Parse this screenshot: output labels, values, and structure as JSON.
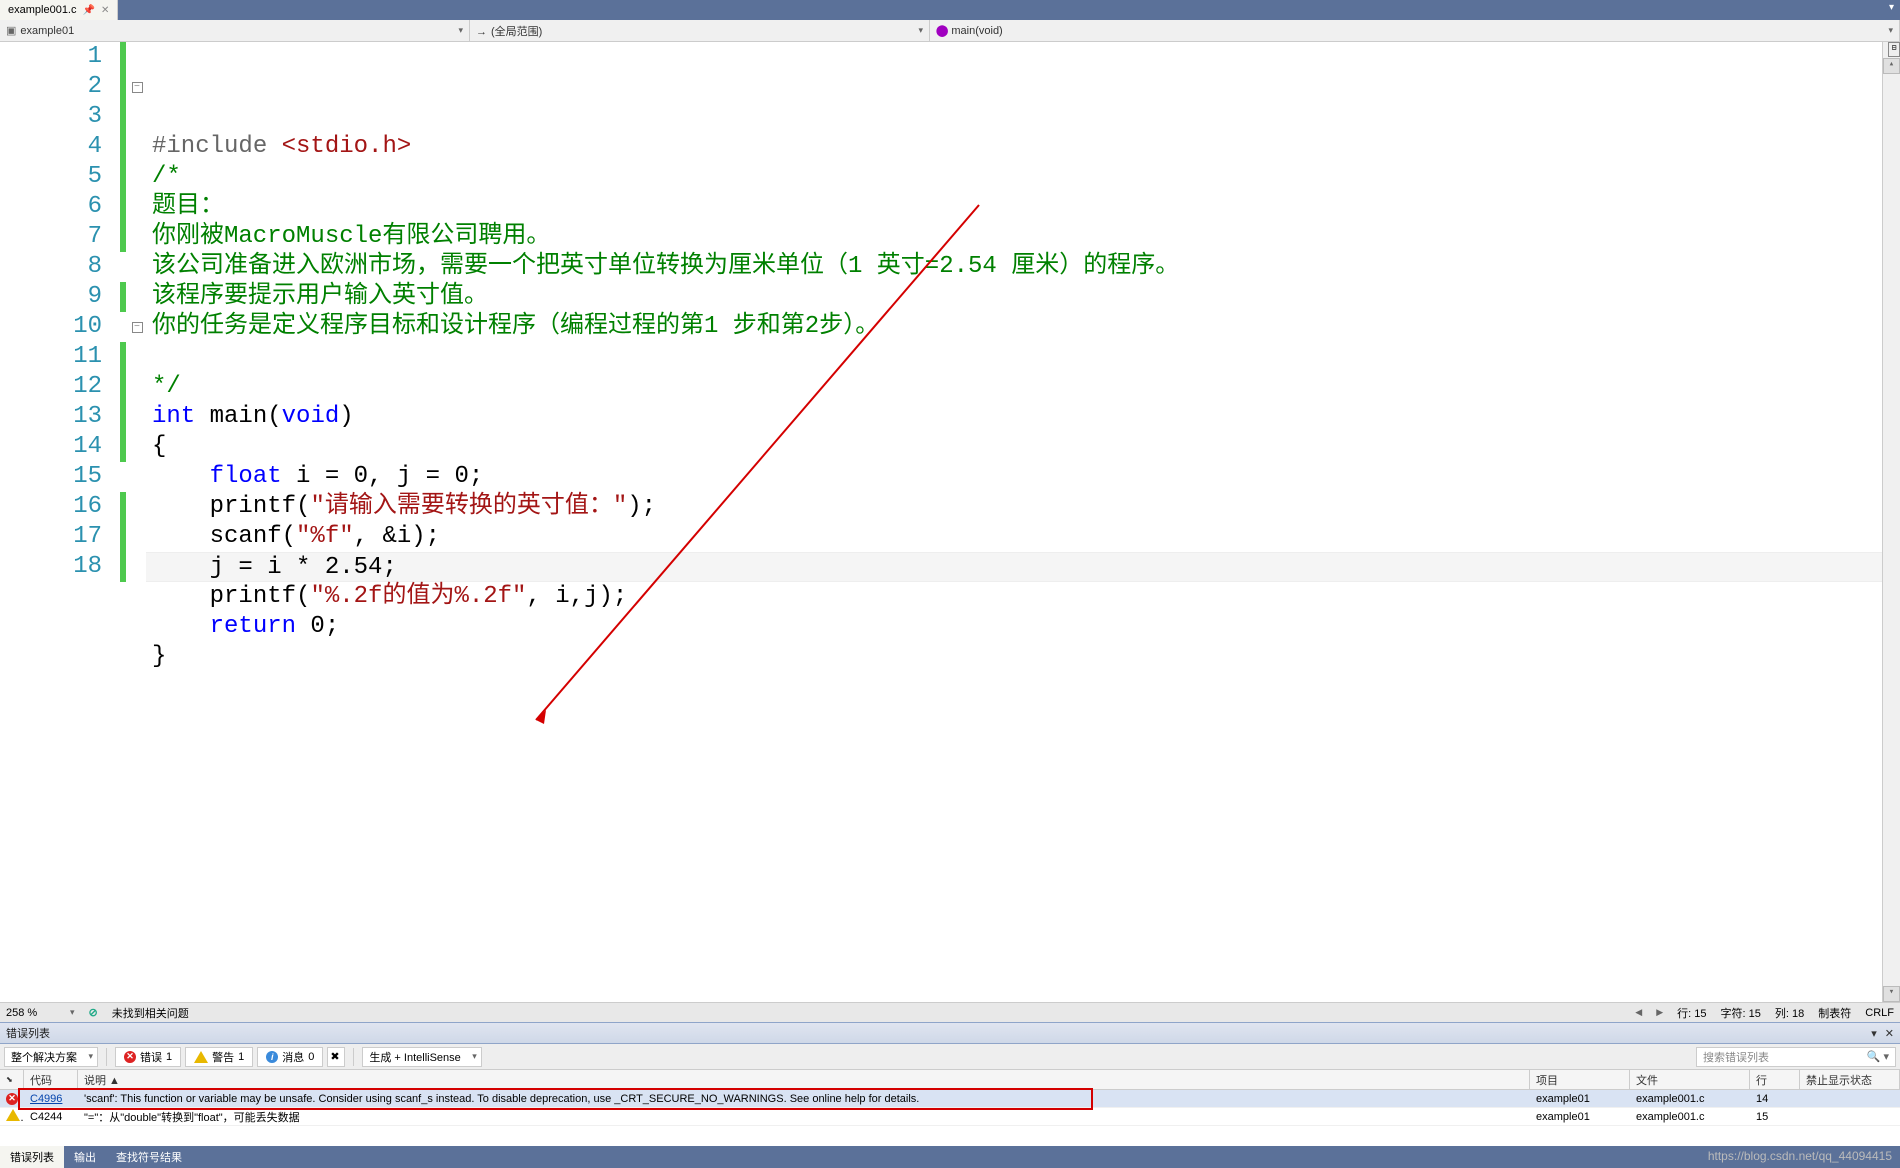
{
  "tabs": {
    "file": "example001.c"
  },
  "navbar": {
    "left": "example01",
    "middle": "(全局范围)",
    "right": "main(void)"
  },
  "code": {
    "lines": [
      {
        "n": 1,
        "html": "<span class='preproc'>#include</span> <span class='string'>&lt;stdio.h&gt;</span>",
        "changed": true
      },
      {
        "n": 2,
        "html": "<span class='comment'>/*</span>",
        "changed": true,
        "outline": "-"
      },
      {
        "n": 3,
        "html": "<span class='comment'>题目：</span>",
        "changed": true
      },
      {
        "n": 4,
        "html": "<span class='comment'>你刚被MacroMuscle有限公司聘用。</span>",
        "changed": true
      },
      {
        "n": 5,
        "html": "<span class='comment'>该公司准备进入欧洲市场，需要一个把英寸单位转换为厘米单位（1 英寸=2.54 厘米）的程序。</span>",
        "changed": true
      },
      {
        "n": 6,
        "html": "<span class='comment'>该程序要提示用户输入英寸值。</span>",
        "changed": true
      },
      {
        "n": 7,
        "html": "<span class='comment'>你的任务是定义程序目标和设计程序（编程过程的第1 步和第2步）。</span>",
        "changed": true
      },
      {
        "n": 8,
        "html": "",
        "changed": false
      },
      {
        "n": 9,
        "html": "<span class='comment'>*/</span>",
        "changed": true
      },
      {
        "n": 10,
        "html": "<span class='keyword'>int</span> main(<span class='keyword'>void</span>)",
        "changed": false,
        "outline": "-"
      },
      {
        "n": 11,
        "html": "{",
        "changed": true
      },
      {
        "n": 12,
        "html": "    <span class='keyword'>float</span> i = 0, j = 0;",
        "changed": true
      },
      {
        "n": 13,
        "html": "    printf(<span class='string'>\"请输入需要转换的英寸值：\"</span>);",
        "changed": true
      },
      {
        "n": 14,
        "html": "    scanf(<span class='string'>\"%f\"</span>, &amp;i);",
        "changed": true
      },
      {
        "n": 15,
        "html": "    j = i * 2.54;",
        "changed": false,
        "hl": true
      },
      {
        "n": 16,
        "html": "    printf(<span class='string'>\"%.2f的值为%.2f\"</span>, i,j);",
        "changed": true
      },
      {
        "n": 17,
        "html": "    <span class='keyword'>return</span> 0;",
        "changed": true
      },
      {
        "n": 18,
        "html": "}",
        "changed": true
      }
    ]
  },
  "status": {
    "zoom": "258 %",
    "issues": "未找到相关问题",
    "line_lbl": "行:",
    "line_val": "15",
    "char_lbl": "字符:",
    "char_val": "15",
    "col_lbl": "列:",
    "col_val": "18",
    "tabs_mode": "制表符",
    "crlf": "CRLF"
  },
  "error_panel": {
    "title": "错误列表",
    "scope": "整个解决方案",
    "errors_lbl": "错误",
    "errors_count": "1",
    "warnings_lbl": "警告",
    "warnings_count": "1",
    "messages_lbl": "消息",
    "messages_count": "0",
    "build_src": "生成 + IntelliSense",
    "search_ph": "搜索错误列表",
    "cols": {
      "code": "代码",
      "desc": "说明 ▲",
      "proj": "项目",
      "file": "文件",
      "line": "行",
      "suppress": "禁止显示状态"
    },
    "rows": [
      {
        "sev": "err",
        "code": "C4996",
        "desc": "'scanf': This function or variable may be unsafe. Consider using scanf_s instead. To disable deprecation, use _CRT_SECURE_NO_WARNINGS. See online help for details.",
        "proj": "example01",
        "file": "example001.c",
        "line": "14",
        "suppress": ""
      },
      {
        "sev": "warn",
        "code": "C4244",
        "desc": "\"=\"：从\"double\"转换到\"float\"，可能丢失数据",
        "proj": "example01",
        "file": "example001.c",
        "line": "15",
        "suppress": ""
      }
    ]
  },
  "footer": {
    "tabs": [
      "错误列表",
      "输出",
      "查找符号结果"
    ],
    "active": 0,
    "watermark": "https://blog.csdn.net/qq_44094415"
  }
}
